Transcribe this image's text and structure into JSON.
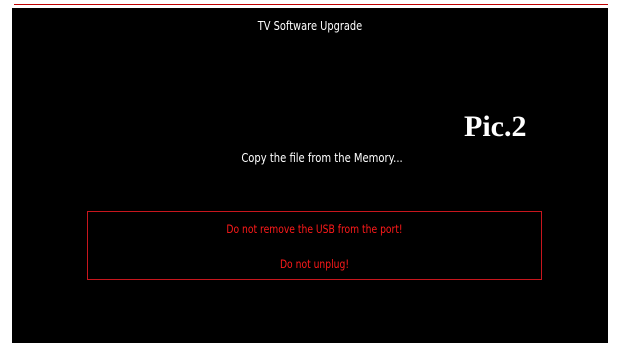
{
  "screen": {
    "title": "TV Software Upgrade",
    "status": "Copy the file from the Memory...",
    "label": "Pic.2"
  },
  "warning": {
    "line1": "Do not remove the USB from the port!",
    "line2": "Do not unplug!"
  },
  "colors": {
    "background": "#000000",
    "text": "#ffffff",
    "warning": "#ff1a1a",
    "rule": "#c00000"
  }
}
